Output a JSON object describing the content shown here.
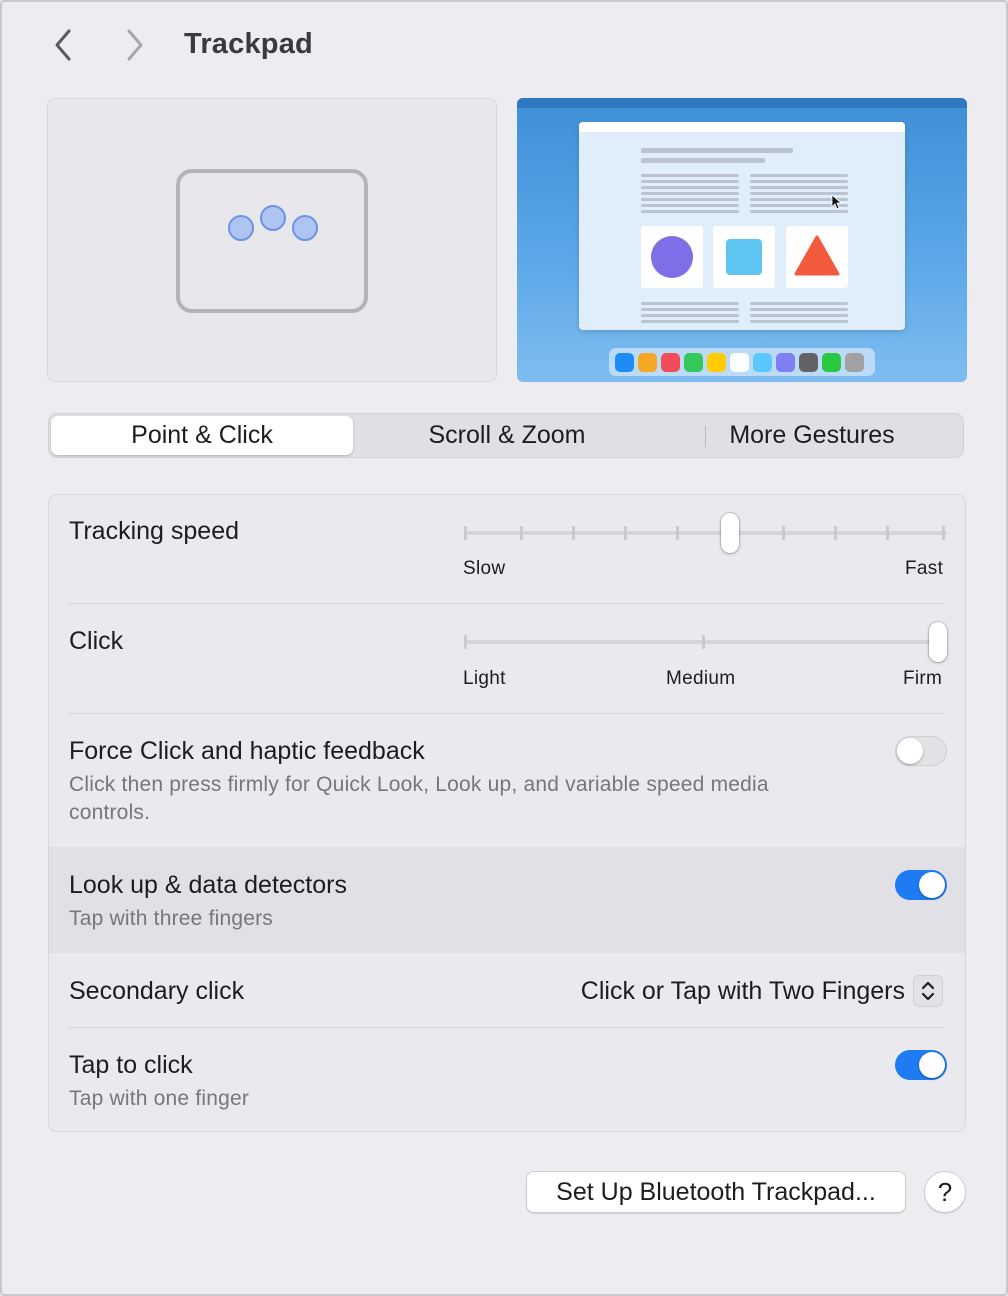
{
  "header": {
    "title": "Trackpad",
    "back_icon": "chevron-left-icon",
    "forward_icon": "chevron-right-icon"
  },
  "preview": {
    "gesture_icon": "three-finger-trackpad-icon",
    "dock_colors": [
      "#1f8bf4",
      "#f5a623",
      "#f24b5a",
      "#34c759",
      "#ffcc00",
      "#ffffff",
      "#5ac8fa",
      "#7e7ff3",
      "#636366",
      "#28c840",
      "#a0a0a5"
    ]
  },
  "tabs": [
    {
      "label": "Point & Click",
      "selected": true
    },
    {
      "label": "Scroll & Zoom",
      "selected": false
    },
    {
      "label": "More Gestures",
      "selected": false
    }
  ],
  "tracking_speed": {
    "label": "Tracking speed",
    "min_label": "Slow",
    "max_label": "Fast",
    "ticks": 10,
    "value": 0.555
  },
  "click": {
    "label": "Click",
    "labels": [
      "Light",
      "Medium",
      "Firm"
    ],
    "value": 1.0
  },
  "force_click": {
    "label": "Force Click and haptic feedback",
    "description": "Click then press firmly for Quick Look, Look up, and variable speed media controls.",
    "enabled": false
  },
  "lookup": {
    "label": "Look up & data detectors",
    "description": "Tap with three fingers",
    "enabled": true
  },
  "secondary_click": {
    "label": "Secondary click",
    "value": "Click or Tap with Two Fingers",
    "icon": "up-down-chevron-icon"
  },
  "tap_to_click": {
    "label": "Tap to click",
    "description": "Tap with one finger",
    "enabled": true
  },
  "footer": {
    "setup_button": "Set Up Bluetooth Trackpad...",
    "help_button": "?"
  },
  "colors": {
    "accent": "#1f7bf2"
  }
}
